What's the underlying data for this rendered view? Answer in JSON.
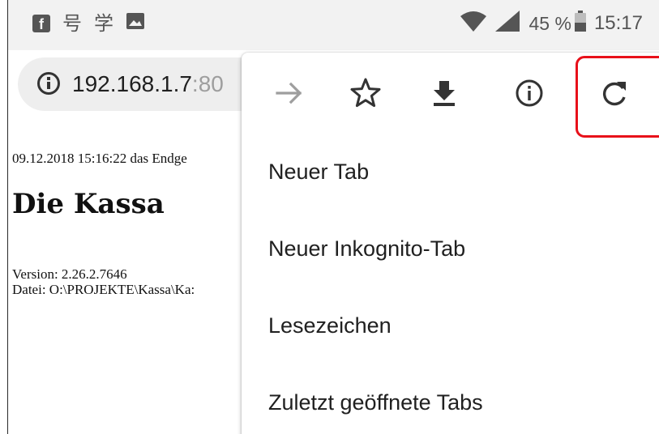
{
  "status_bar": {
    "icons": [
      "facebook-icon",
      "chinese-app-icon-hao",
      "chinese-app-icon-xue",
      "image-icon",
      "wifi-icon",
      "signal-icon",
      "battery-icon"
    ],
    "glyph_hao": "号",
    "glyph_xue": "学",
    "fb_letter": "f",
    "battery": "45 %",
    "time": "15:17"
  },
  "omnibox": {
    "url_host": "192.168.1.7",
    "url_port": ":80"
  },
  "page": {
    "timestamp_line": "09.12.2018 15:16:22 das Endge",
    "title": "Die Kassa",
    "version": "Version: 2.26.2.7646",
    "datei": "Datei: O:\\PROJEKTE\\Kassa\\Ka:"
  },
  "menu": {
    "icon_row": [
      "forward-icon",
      "star-icon",
      "download-icon",
      "info-icon",
      "refresh-icon"
    ],
    "items": [
      {
        "label": "Neuer Tab"
      },
      {
        "label": "Neuer Inkognito-Tab"
      },
      {
        "label": "Lesezeichen"
      },
      {
        "label": "Zuletzt geöffnete Tabs"
      }
    ],
    "highlight_color": "#e8101a"
  },
  "colors": {
    "status_bar_bg": "#f2f2f2",
    "omnibox_bg": "#eeeeee",
    "icon_dark": "#333333",
    "icon_disabled": "#9e9e9e"
  }
}
